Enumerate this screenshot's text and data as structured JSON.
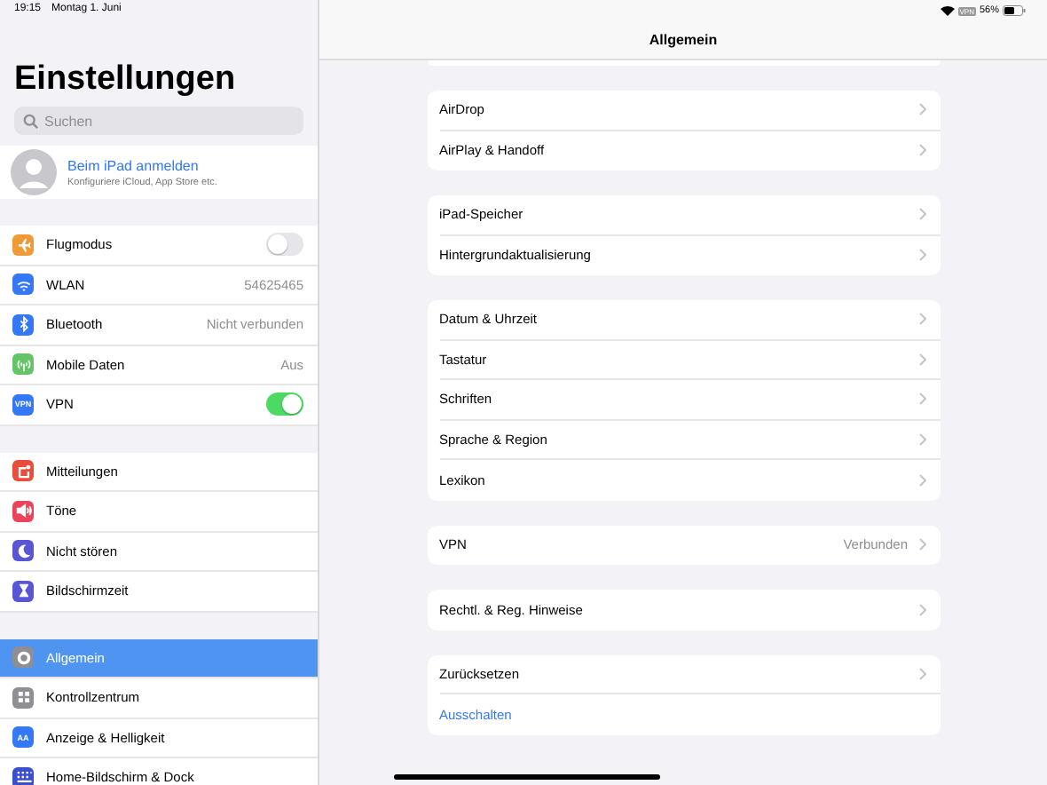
{
  "status_bar": {
    "time": "19:15",
    "date": "Montag 1. Juni",
    "vpn_badge": "VPN",
    "battery": "56%"
  },
  "sidebar": {
    "title": "Einstellungen",
    "search": {
      "placeholder": "Suchen"
    },
    "profile": {
      "name": "Beim iPad anmelden",
      "subtitle": "Konfiguriere iCloud, App Store etc."
    },
    "groups": [
      [
        {
          "label": "Flugmodus",
          "color": "#f09a37",
          "kind": "toggle",
          "on": false,
          "selected": false
        },
        {
          "label": "WLAN",
          "color": "#3478f6",
          "kind": "value",
          "value": "54625465",
          "selected": false
        },
        {
          "label": "Bluetooth",
          "color": "#3478f6",
          "kind": "value",
          "value": "Nicht verbunden",
          "selected": false
        },
        {
          "label": "Mobile Daten",
          "color": "#65c466",
          "kind": "value",
          "value": "Aus",
          "selected": false
        },
        {
          "label": "VPN",
          "color": "#3478f6",
          "kind": "toggle",
          "on": true,
          "icon_text": "VPN",
          "selected": false
        }
      ],
      [
        {
          "label": "Mitteilungen",
          "color": "#eb4d3d",
          "kind": "link",
          "selected": false
        },
        {
          "label": "Töne",
          "color": "#eb445a",
          "kind": "link",
          "selected": false
        },
        {
          "label": "Nicht stören",
          "color": "#5956d6",
          "kind": "link",
          "selected": false
        },
        {
          "label": "Bildschirmzeit",
          "color": "#5956d6",
          "kind": "link",
          "selected": false
        }
      ],
      [
        {
          "label": "Allgemein",
          "color": "#8e8e93",
          "kind": "link",
          "selected": true
        },
        {
          "label": "Kontrollzentrum",
          "color": "#8e8e93",
          "kind": "link",
          "selected": false
        },
        {
          "label": "Anzeige & Helligkeit",
          "color": "#3478f6",
          "kind": "link",
          "icon_text": "AA",
          "selected": false
        },
        {
          "label": "Home-Bildschirm & Dock",
          "color": "#3a4fd0",
          "kind": "link",
          "selected": false
        }
      ]
    ]
  },
  "detail": {
    "title": "Allgemein",
    "groups": [
      [
        {
          "label": "AirDrop",
          "kind": "link"
        },
        {
          "label": "AirPlay & Handoff",
          "kind": "link"
        }
      ],
      [
        {
          "label": "iPad-Speicher",
          "kind": "link"
        },
        {
          "label": "Hintergrundaktualisierung",
          "kind": "link"
        }
      ],
      [
        {
          "label": "Datum & Uhrzeit",
          "kind": "link"
        },
        {
          "label": "Tastatur",
          "kind": "link"
        },
        {
          "label": "Schriften",
          "kind": "link"
        },
        {
          "label": "Sprache & Region",
          "kind": "link"
        },
        {
          "label": "Lexikon",
          "kind": "link"
        }
      ],
      [
        {
          "label": "VPN",
          "kind": "link",
          "value": "Verbunden"
        }
      ],
      [
        {
          "label": "Rechtl. & Reg. Hinweise",
          "kind": "link"
        }
      ],
      [
        {
          "label": "Zurücksetzen",
          "kind": "link"
        },
        {
          "label": "Ausschalten",
          "kind": "action"
        }
      ]
    ]
  }
}
